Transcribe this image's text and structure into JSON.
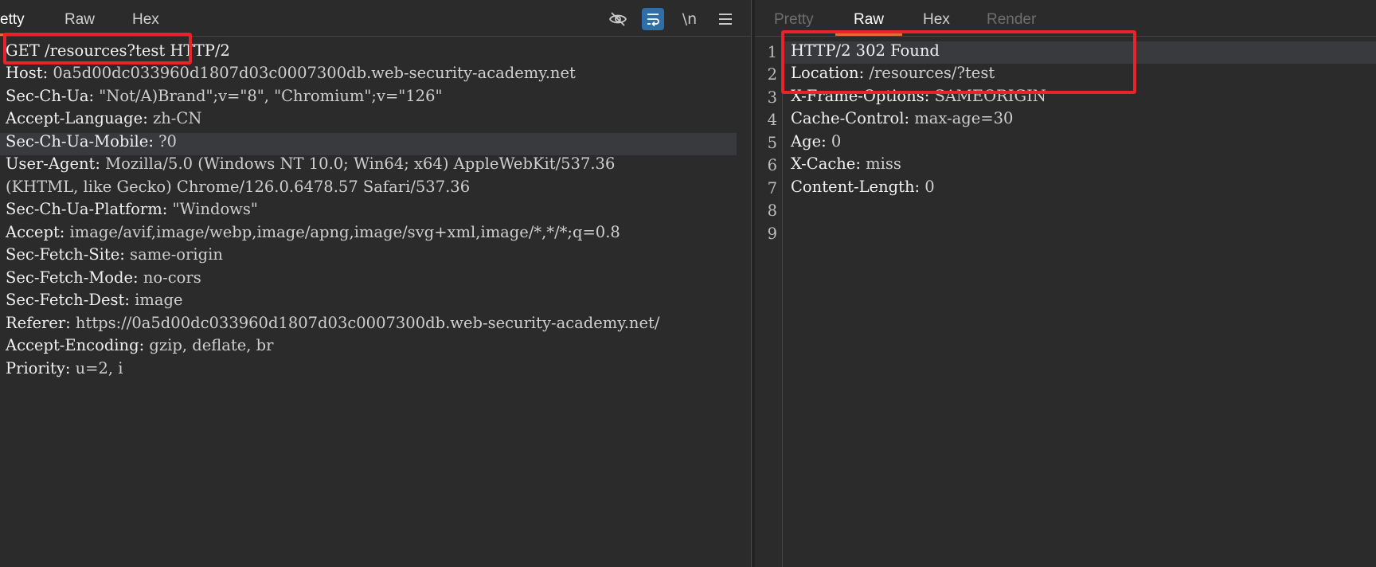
{
  "request": {
    "tabs": [
      {
        "label": "etty"
      },
      {
        "label": "Raw"
      },
      {
        "label": "Hex"
      }
    ],
    "toolbar": {
      "hide_icon": "eye-slash-icon",
      "wrap_icon": "word-wrap-icon",
      "newline_label": "\\n",
      "menu_icon": "hamburger-menu-icon"
    },
    "lines": [
      {
        "key": "GET /resources?test HTTP/2",
        "value": ""
      },
      {
        "key": "Host:",
        "value": " 0a5d00dc033960d1807d03c0007300db.web-security-academy.net"
      },
      {
        "key": "Sec-Ch-Ua:",
        "value": " \"Not/A)Brand\";v=\"8\", \"Chromium\";v=\"126\""
      },
      {
        "key": "Accept-Language:",
        "value": " zh-CN"
      },
      {
        "key": "Sec-Ch-Ua-Mobile:",
        "value": " ?0"
      },
      {
        "key": "User-Agent:",
        "value": " Mozilla/5.0 (Windows NT 10.0; Win64; x64) AppleWebKit/537.36"
      },
      {
        "key": "",
        "value": "(KHTML, like Gecko) Chrome/126.0.6478.57 Safari/537.36"
      },
      {
        "key": "Sec-Ch-Ua-Platform:",
        "value": " \"Windows\""
      },
      {
        "key": "Accept:",
        "value": " image/avif,image/webp,image/apng,image/svg+xml,image/*,*/*;q=0.8"
      },
      {
        "key": "Sec-Fetch-Site:",
        "value": " same-origin"
      },
      {
        "key": "Sec-Fetch-Mode:",
        "value": " no-cors"
      },
      {
        "key": "Sec-Fetch-Dest:",
        "value": " image"
      },
      {
        "key": "Referer:",
        "value": " https://0a5d00dc033960d1807d03c0007300db.web-security-academy.net/"
      },
      {
        "key": "Accept-Encoding:",
        "value": " gzip, deflate, br"
      },
      {
        "key": "Priority:",
        "value": " u=2, i"
      }
    ]
  },
  "response": {
    "tabs": [
      {
        "label": "Pretty"
      },
      {
        "label": "Raw"
      },
      {
        "label": "Hex"
      },
      {
        "label": "Render"
      }
    ],
    "line_numbers": [
      "1",
      "2",
      "3",
      "4",
      "5",
      "6",
      "7",
      "8",
      "9"
    ],
    "lines": [
      {
        "key": "HTTP/2 302 Found",
        "value": ""
      },
      {
        "key": "Location:",
        "value": " /resources/?test"
      },
      {
        "key": "X-Frame-Options:",
        "value": " SAMEORIGIN"
      },
      {
        "key": "Cache-Control:",
        "value": " max-age=30"
      },
      {
        "key": "Age:",
        "value": " 0"
      },
      {
        "key": "X-Cache:",
        "value": " miss"
      },
      {
        "key": "Content-Length:",
        "value": " 0"
      },
      {
        "key": "",
        "value": ""
      },
      {
        "key": "",
        "value": ""
      }
    ]
  },
  "colors": {
    "background": "#2b2b2b",
    "highlight_box": "#e8232b",
    "active_tab_underline": "#e8693b",
    "toggle_on": "#2f6ea8"
  }
}
